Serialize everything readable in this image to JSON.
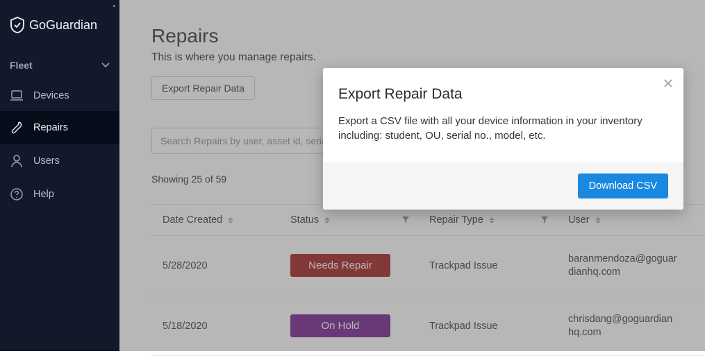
{
  "brand": "GoGuardian",
  "sidebar": {
    "section": "Fleet",
    "items": [
      {
        "label": "Devices"
      },
      {
        "label": "Repairs"
      },
      {
        "label": "Users"
      },
      {
        "label": "Help"
      }
    ]
  },
  "page": {
    "title": "Repairs",
    "subtitle": "This is where you manage repairs.",
    "export_button": "Export Repair Data",
    "search_placeholder": "Search Repairs by user, asset id, serial number",
    "showing": "Showing 25 of 59"
  },
  "table": {
    "headers": {
      "date": "Date Created",
      "status": "Status",
      "type": "Repair Type",
      "user": "User"
    },
    "rows": [
      {
        "date": "5/28/2020",
        "status": "Needs Repair",
        "status_class": "status-red",
        "type": "Trackpad Issue",
        "user": "baranmendoza@goguardianhq.com"
      },
      {
        "date": "5/18/2020",
        "status": "On Hold",
        "status_class": "status-purple",
        "type": "Trackpad Issue",
        "user": "chrisdang@goguardianhq.com"
      }
    ]
  },
  "modal": {
    "title": "Export Repair Data",
    "text": "Export a CSV file with all your device information in your inventory including: student, OU, serial no., model, etc.",
    "button": "Download CSV"
  }
}
